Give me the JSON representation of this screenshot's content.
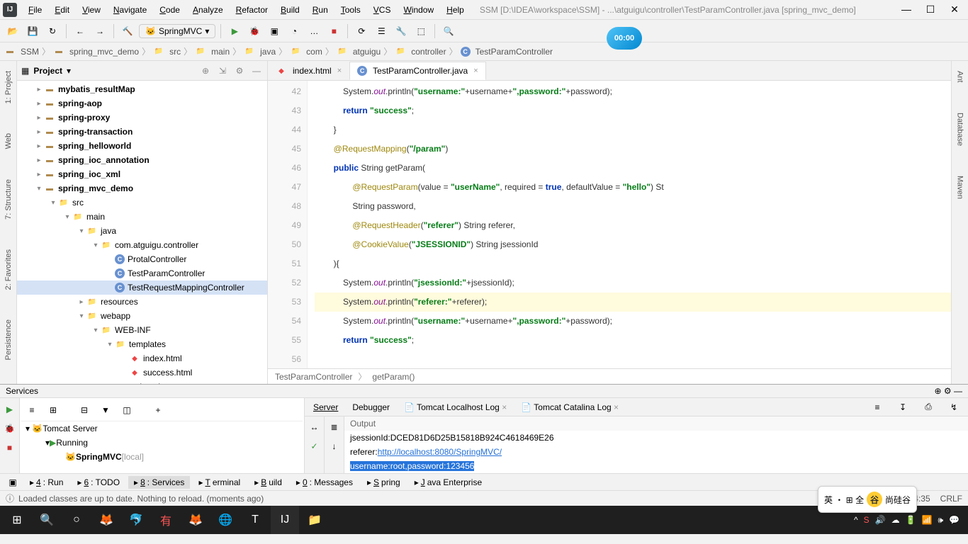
{
  "window": {
    "title": "SSM [D:\\IDEA\\workspace\\SSM] - ...\\atguigu\\controller\\TestParamController.java [spring_mvc_demo]"
  },
  "menubar": [
    "File",
    "Edit",
    "View",
    "Navigate",
    "Code",
    "Analyze",
    "Refactor",
    "Build",
    "Run",
    "Tools",
    "VCS",
    "Window",
    "Help"
  ],
  "run_config": "SpringMVC",
  "timer": "00:00",
  "breadcrumb": [
    {
      "icon": "module",
      "label": "SSM"
    },
    {
      "icon": "module",
      "label": "spring_mvc_demo"
    },
    {
      "icon": "folder",
      "label": "src"
    },
    {
      "icon": "folder",
      "label": "main"
    },
    {
      "icon": "folder",
      "label": "java"
    },
    {
      "icon": "folder",
      "label": "com"
    },
    {
      "icon": "folder",
      "label": "atguigu"
    },
    {
      "icon": "folder",
      "label": "controller"
    },
    {
      "icon": "class",
      "label": "TestParamController"
    }
  ],
  "project_panel": {
    "title": "Project"
  },
  "left_tabs": [
    "1: Project",
    "Web",
    "7: Structure",
    "2: Favorites",
    "Persistence"
  ],
  "right_tabs": [
    "Ant",
    "Database",
    "Maven"
  ],
  "tree": [
    {
      "indent": 2,
      "arrow": ">",
      "icon": "module",
      "label": "mybatis_resultMap",
      "bold": true
    },
    {
      "indent": 2,
      "arrow": ">",
      "icon": "module",
      "label": "spring-aop",
      "bold": true
    },
    {
      "indent": 2,
      "arrow": ">",
      "icon": "module",
      "label": "spring-proxy",
      "bold": true
    },
    {
      "indent": 2,
      "arrow": ">",
      "icon": "module",
      "label": "spring-transaction",
      "bold": true
    },
    {
      "indent": 2,
      "arrow": ">",
      "icon": "module",
      "label": "spring_helloworld",
      "bold": true
    },
    {
      "indent": 2,
      "arrow": ">",
      "icon": "module",
      "label": "spring_ioc_annotation",
      "bold": true
    },
    {
      "indent": 2,
      "arrow": ">",
      "icon": "module",
      "label": "spring_ioc_xml",
      "bold": true
    },
    {
      "indent": 2,
      "arrow": "v",
      "icon": "module",
      "label": "spring_mvc_demo",
      "bold": true
    },
    {
      "indent": 4,
      "arrow": "v",
      "icon": "folder",
      "label": "src"
    },
    {
      "indent": 6,
      "arrow": "v",
      "icon": "folder",
      "label": "main"
    },
    {
      "indent": 8,
      "arrow": "v",
      "icon": "folder-src",
      "label": "java"
    },
    {
      "indent": 10,
      "arrow": "v",
      "icon": "folder",
      "label": "com.atguigu.controller"
    },
    {
      "indent": 12,
      "arrow": "",
      "icon": "class",
      "label": "ProtalController"
    },
    {
      "indent": 12,
      "arrow": "",
      "icon": "class",
      "label": "TestParamController"
    },
    {
      "indent": 12,
      "arrow": "",
      "icon": "class",
      "label": "TestRequestMappingController",
      "selected": true
    },
    {
      "indent": 8,
      "arrow": ">",
      "icon": "folder-res",
      "label": "resources"
    },
    {
      "indent": 8,
      "arrow": "v",
      "icon": "folder-web",
      "label": "webapp"
    },
    {
      "indent": 10,
      "arrow": "v",
      "icon": "folder",
      "label": "WEB-INF"
    },
    {
      "indent": 12,
      "arrow": "v",
      "icon": "folder",
      "label": "templates"
    },
    {
      "indent": 14,
      "arrow": "",
      "icon": "html",
      "label": "index.html"
    },
    {
      "indent": 14,
      "arrow": "",
      "icon": "html",
      "label": "success.html"
    },
    {
      "indent": 12,
      "arrow": "",
      "icon": "xml",
      "label": "web.xml"
    }
  ],
  "editor_tabs": [
    {
      "icon": "html",
      "label": "index.html",
      "active": false
    },
    {
      "icon": "class",
      "label": "TestParamController.java",
      "active": true
    }
  ],
  "line_numbers": [
    42,
    43,
    44,
    45,
    46,
    47,
    48,
    49,
    50,
    51,
    52,
    53,
    54,
    55,
    56
  ],
  "code_lines": [
    {
      "n": 42,
      "segs": [
        {
          "t": "            System."
        },
        {
          "t": "out",
          "c": "static"
        },
        {
          "t": ".println("
        },
        {
          "t": "\"username:\"",
          "c": "str"
        },
        {
          "t": "+username+"
        },
        {
          "t": "\",password:\"",
          "c": "str"
        },
        {
          "t": "+password);"
        }
      ]
    },
    {
      "n": 43,
      "segs": [
        {
          "t": "            "
        },
        {
          "t": "return ",
          "c": "kw"
        },
        {
          "t": "\"success\"",
          "c": "str"
        },
        {
          "t": ";"
        }
      ]
    },
    {
      "n": 44,
      "segs": [
        {
          "t": "        }"
        }
      ]
    },
    {
      "n": 45,
      "segs": [
        {
          "t": ""
        }
      ]
    },
    {
      "n": 46,
      "segs": [
        {
          "t": "        "
        },
        {
          "t": "@RequestMapping",
          "c": "ann"
        },
        {
          "t": "("
        },
        {
          "t": "\"/param\"",
          "c": "str"
        },
        {
          "t": ")"
        }
      ]
    },
    {
      "n": 47,
      "segs": [
        {
          "t": "        "
        },
        {
          "t": "public ",
          "c": "kw"
        },
        {
          "t": "String getParam("
        }
      ]
    },
    {
      "n": 48,
      "segs": [
        {
          "t": "                "
        },
        {
          "t": "@RequestParam",
          "c": "ann"
        },
        {
          "t": "(value = "
        },
        {
          "t": "\"userName\"",
          "c": "str"
        },
        {
          "t": ", required = "
        },
        {
          "t": "true",
          "c": "kw"
        },
        {
          "t": ", defaultValue = "
        },
        {
          "t": "\"hello\"",
          "c": "str"
        },
        {
          "t": ") St"
        }
      ]
    },
    {
      "n": 49,
      "segs": [
        {
          "t": "                String password,"
        }
      ]
    },
    {
      "n": 50,
      "segs": [
        {
          "t": "                "
        },
        {
          "t": "@RequestHeader",
          "c": "ann"
        },
        {
          "t": "("
        },
        {
          "t": "\"referer\"",
          "c": "str"
        },
        {
          "t": ") String referer,"
        }
      ]
    },
    {
      "n": 51,
      "segs": [
        {
          "t": "                "
        },
        {
          "t": "@CookieValue",
          "c": "ann"
        },
        {
          "t": "("
        },
        {
          "t": "\"JSESSIONID\"",
          "c": "str"
        },
        {
          "t": ") String jsessionId"
        }
      ]
    },
    {
      "n": 52,
      "segs": [
        {
          "t": "        ){"
        }
      ]
    },
    {
      "n": 53,
      "segs": [
        {
          "t": "            System."
        },
        {
          "t": "out",
          "c": "static"
        },
        {
          "t": ".println("
        },
        {
          "t": "\"jsessionId:\"",
          "c": "str"
        },
        {
          "t": "+jsessionId);"
        }
      ]
    },
    {
      "n": 54,
      "hl": true,
      "segs": [
        {
          "t": "            System."
        },
        {
          "t": "out",
          "c": "static"
        },
        {
          "t": ".println("
        },
        {
          "t": "\"referer:\"",
          "c": "str"
        },
        {
          "t": "+referer);"
        }
      ]
    },
    {
      "n": 55,
      "segs": [
        {
          "t": "            System."
        },
        {
          "t": "out",
          "c": "static"
        },
        {
          "t": ".println("
        },
        {
          "t": "\"username:\"",
          "c": "str"
        },
        {
          "t": "+username+"
        },
        {
          "t": "\",password:\"",
          "c": "str"
        },
        {
          "t": "+password);"
        }
      ]
    },
    {
      "n": 56,
      "segs": [
        {
          "t": "            "
        },
        {
          "t": "return ",
          "c": "kw"
        },
        {
          "t": "\"success\"",
          "c": "str"
        },
        {
          "t": ";"
        }
      ]
    }
  ],
  "editor_crumb": [
    "TestParamController",
    "getParam()"
  ],
  "services": {
    "title": "Services",
    "tree": [
      {
        "indent": 0,
        "arrow": "v",
        "icon": "tomcat",
        "label": "Tomcat Server"
      },
      {
        "indent": 2,
        "arrow": "v",
        "icon": "run",
        "label": "Running"
      },
      {
        "indent": 4,
        "arrow": "",
        "icon": "tomcat",
        "label": "SpringMVC",
        "suffix": "[local]",
        "bold": true
      }
    ],
    "tabs": [
      "Server",
      "Debugger",
      "Tomcat Localhost Log",
      "Tomcat Catalina Log"
    ],
    "output_label": "Output",
    "output": [
      {
        "segs": [
          {
            "t": "jsessionId:DCED81D6D25B15818B924C4618469E26"
          }
        ]
      },
      {
        "segs": [
          {
            "t": "referer:"
          },
          {
            "t": "http://localhost:8080/SpringMVC/",
            "c": "link"
          }
        ]
      },
      {
        "segs": [
          {
            "t": "username:root,password:123456",
            "c": "sel"
          }
        ]
      }
    ]
  },
  "bottom_tabs": [
    {
      "icon": "run",
      "label": "4: Run"
    },
    {
      "icon": "todo",
      "label": "6: TODO"
    },
    {
      "icon": "services",
      "label": "8: Services",
      "active": true
    },
    {
      "icon": "terminal",
      "label": "Terminal"
    },
    {
      "icon": "build",
      "label": "Build"
    },
    {
      "icon": "messages",
      "label": "0: Messages"
    },
    {
      "icon": "spring",
      "label": "Spring"
    },
    {
      "icon": "java",
      "label": "Java Enterprise"
    }
  ],
  "statusbar": {
    "message": "Loaded classes are up to date. Nothing to reload. (moments ago)",
    "position": "54:35",
    "line_ending": "CRLF",
    "encoding": ""
  },
  "ime": {
    "brand": "尚硅谷",
    "lang": "英"
  },
  "tray": {
    "time": ""
  }
}
